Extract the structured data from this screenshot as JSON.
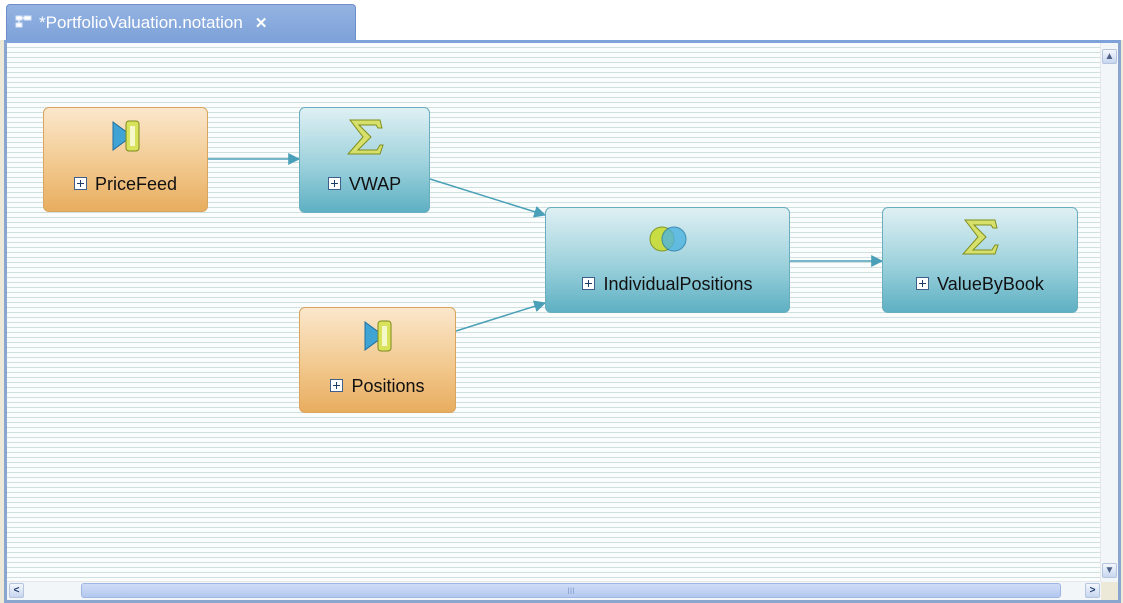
{
  "tab": {
    "title": "*PortfolioValuation.notation",
    "close_label": "✕",
    "icon": "diagram-icon"
  },
  "colors": {
    "stream_node": "#f2c98f",
    "operator_node": "#9cd1dc",
    "edge": "#4aa0b8",
    "tab": "#7ea2d9"
  },
  "diagram": {
    "nodes": [
      {
        "id": "PriceFeed",
        "label": "PriceFeed",
        "kind": "stream",
        "icon": "stream-source-icon"
      },
      {
        "id": "VWAP",
        "label": "VWAP",
        "kind": "aggregate",
        "icon": "sigma-icon"
      },
      {
        "id": "Positions",
        "label": "Positions",
        "kind": "stream",
        "icon": "stream-source-icon"
      },
      {
        "id": "IndividualPositions",
        "label": "IndividualPositions",
        "kind": "join",
        "icon": "join-icon"
      },
      {
        "id": "ValueByBook",
        "label": "ValueByBook",
        "kind": "aggregate",
        "icon": "sigma-icon"
      }
    ],
    "edges": [
      {
        "from": "PriceFeed",
        "to": "VWAP"
      },
      {
        "from": "VWAP",
        "to": "IndividualPositions"
      },
      {
        "from": "Positions",
        "to": "IndividualPositions"
      },
      {
        "from": "IndividualPositions",
        "to": "ValueByBook"
      }
    ]
  },
  "scrollbars": {
    "thumb_grip": "III"
  }
}
